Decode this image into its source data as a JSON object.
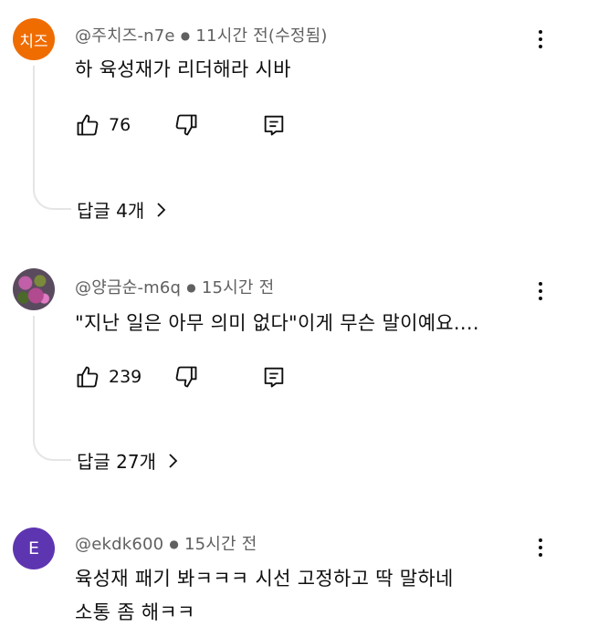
{
  "comments": [
    {
      "avatar_text": "치즈",
      "avatar_color": "#ef6c00",
      "author": "@주치즈-n7e",
      "time": "11시간 전(수정됨)",
      "text_lines": [
        "하 육성재가 리더해라 시바"
      ],
      "likes": "76",
      "replies": "답글 4개"
    },
    {
      "avatar_text": "",
      "avatar_color": "#5a4a5e",
      "author": "@양금순-m6q",
      "time": "15시간 전",
      "text_lines": [
        "\"지난 일은 아무 의미 없다\"이게 무슨 말이예요...."
      ],
      "likes": "239",
      "replies": "답글 27개"
    },
    {
      "avatar_text": "E",
      "avatar_color": "#5e35b1",
      "author": "@ekdk600",
      "time": "15시간 전",
      "text_lines": [
        "육성재 패기 봐ㅋㅋㅋ 시선 고정하고 딱 말하네",
        "소통 좀 해ㅋㅋ"
      ]
    }
  ],
  "icons": {
    "like": "thumbs-up-icon",
    "dislike": "thumbs-down-icon",
    "reply": "reply-comment-icon",
    "more": "more-vertical-icon",
    "expand": "chevron-right-icon"
  }
}
